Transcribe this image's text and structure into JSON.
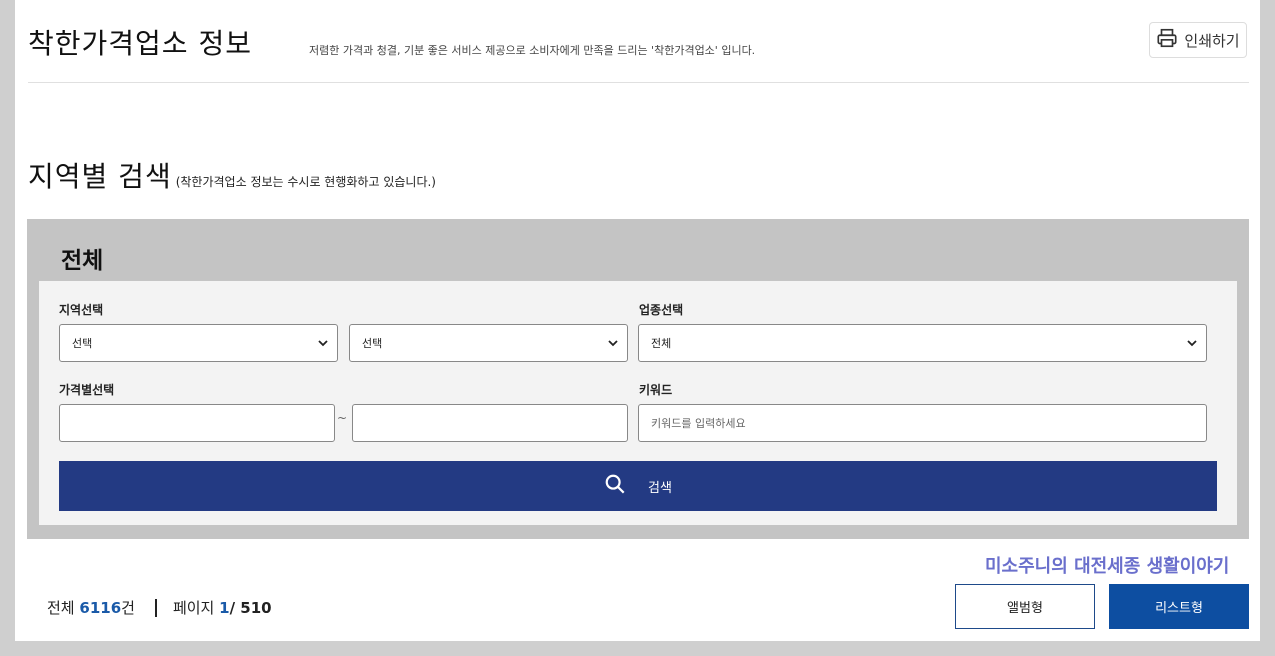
{
  "header": {
    "title": "착한가격업소 정보",
    "subtitle": "저렴한 가격과 청결, 기분 좋은 서비스 제공으로 소비자에게 만족을 드리는 '착한가격업소' 입니다.",
    "print_label": "인쇄하기"
  },
  "section": {
    "title": "지역별 검색",
    "note": "(착한가격업소 정보는 수시로 현행화하고 있습니다.)"
  },
  "search": {
    "panel_title": "전체",
    "region_label": "지역선택",
    "region_select_1": "선택",
    "region_select_2": "선택",
    "category_label": "업종선택",
    "category_select": "전체",
    "price_label": "가격별선택",
    "price_from": "",
    "price_tilde": "~",
    "price_to": "",
    "keyword_label": "키워드",
    "keyword_placeholder": "키워드를 입력하세요",
    "search_button": "검색"
  },
  "blog_link": "미소주니의 대전세종 생활이야기",
  "results": {
    "total_prefix": "전체",
    "total_count": "6116",
    "total_suffix": "건",
    "page_prefix": "페이지",
    "page_current": "1",
    "page_total": "/ 510"
  },
  "view": {
    "album_label": "앨범형",
    "list_label": "리스트형"
  },
  "colors": {
    "search_button_bg": "#233a83",
    "list_button_bg": "#0d4ea1",
    "blog_link": "#6a6fcc",
    "count_number": "#1a5aa8"
  }
}
